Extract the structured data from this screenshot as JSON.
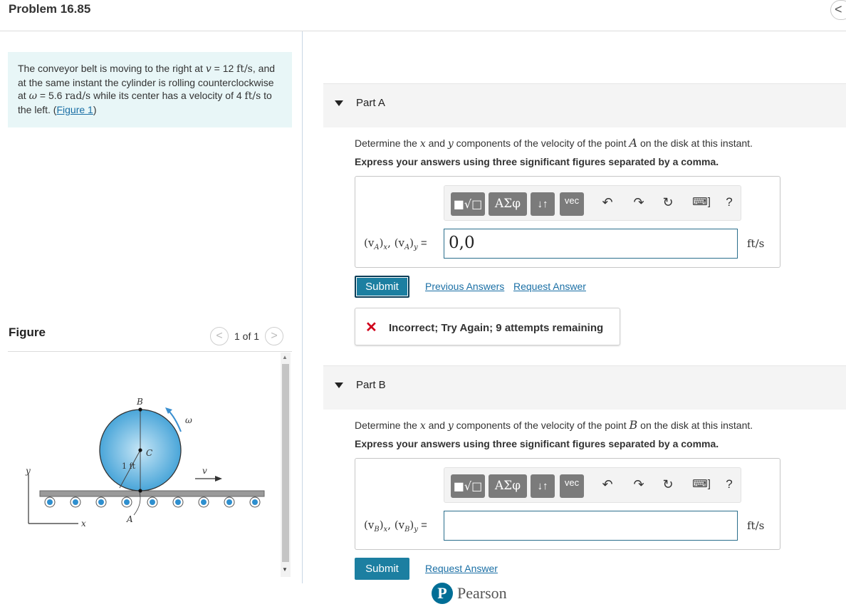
{
  "header": {
    "title": "Problem 16.85",
    "collapse_icon": "<"
  },
  "problem": {
    "t1": "The conveyor belt is moving to the right at ",
    "v_sym": "v",
    "t2": " = 12 ",
    "v_unit": "ft/s",
    "t3": ", and at the same instant the cylinder is rolling counterclockwise at ",
    "w_sym": "ω",
    "t4": " = 5.6 ",
    "w_unit": "rad/s",
    "t5": " while its center has a velocity of 4 ",
    "c_unit": "ft/s",
    "t6": " to the left. (",
    "fig_link": "Figure 1",
    "t7": ")"
  },
  "figure": {
    "title": "Figure",
    "pager": "1 of 1",
    "prev_icon": "<",
    "next_icon": ">",
    "labels": {
      "B": "B",
      "C": "C",
      "A": "A",
      "omega": "ω",
      "v": "v",
      "y": "y",
      "x": "x",
      "radius": "1 ft"
    },
    "colors": {
      "disk": "#5fb4e0",
      "disk_light": "#c7e6f6",
      "belt": "#8e8e8e",
      "roller": "#2e8fcf"
    }
  },
  "partA": {
    "title": "Part A",
    "q_pre": "Determine the ",
    "q_x": "x",
    "q_and": " and ",
    "q_y": "y",
    "q_mid": " components of the velocity of the point ",
    "q_pt": "A",
    "q_post": " on the disk at this instant.",
    "instruction": "Express your answers using three significant figures separated by a comma.",
    "label_a": "(v",
    "label_sub1": "A",
    "label_b": ")",
    "label_sub2": "x",
    "label_c": ", (v",
    "label_sub3": "A",
    "label_d": ")",
    "label_sub4": "y",
    "label_e": " =",
    "input_value": "0,0",
    "unit": "ft/s",
    "submit": "Submit",
    "prev_answers": "Previous Answers",
    "request": "Request Answer",
    "feedback_icon": "✕",
    "feedback": "Incorrect; Try Again; 9 attempts remaining"
  },
  "partB": {
    "title": "Part B",
    "q_pre": "Determine the ",
    "q_x": "x",
    "q_and": " and ",
    "q_y": "y",
    "q_mid": " components of the velocity of the point ",
    "q_pt": "B",
    "q_post": " on the disk at this instant.",
    "instruction": "Express your answers using three significant figures separated by a comma.",
    "label_a": "(v",
    "label_sub1": "B",
    "label_b": ")",
    "label_sub2": "x",
    "label_c": ", (v",
    "label_sub3": "B",
    "label_d": ")",
    "label_sub4": "y",
    "label_e": " =",
    "input_value": "",
    "unit": "ft/s",
    "submit": "Submit",
    "request": "Request Answer"
  },
  "toolbar": {
    "templates": "■√□",
    "greek": "ΑΣφ",
    "arrows": "↓↑",
    "vec": "vec",
    "undo_icon": "↶",
    "redo_icon": "↷",
    "reset_icon": "↻",
    "keyboard_icon": "⌨]",
    "help": "?"
  },
  "footer": {
    "logo_letter": "P",
    "brand": "Pearson"
  }
}
